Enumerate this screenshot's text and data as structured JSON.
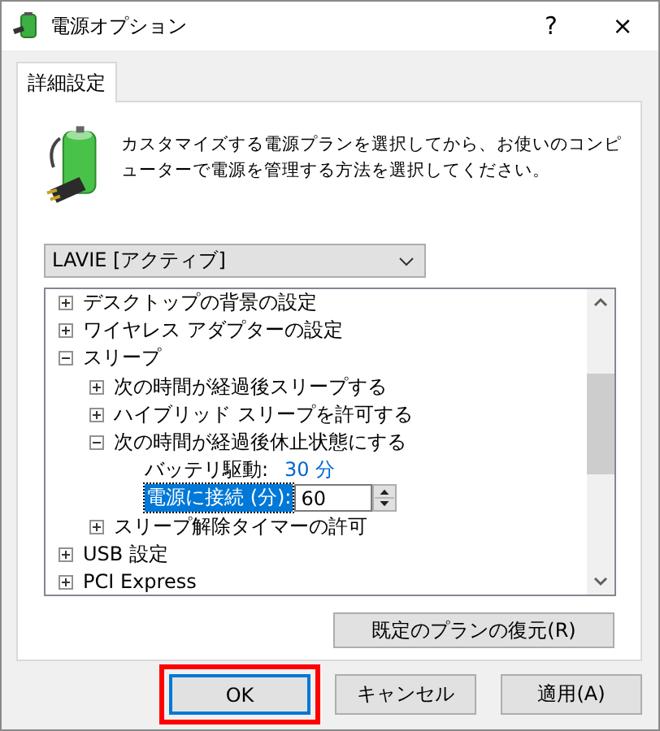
{
  "window": {
    "title": "電源オプション",
    "help": "?",
    "close": "×"
  },
  "tabs": [
    {
      "label": "詳細設定",
      "selected": true
    }
  ],
  "description": "カスタマイズする電源プランを選択してから、お使いのコンピューターで電源を管理する方法を選択してください。",
  "plan_dropdown": {
    "value": "LAVIE [アクティブ]"
  },
  "settings_tree": [
    {
      "label": "デスクトップの背景の設定",
      "expanded": false
    },
    {
      "label": "ワイヤレス アダプターの設定",
      "expanded": false
    },
    {
      "label": "スリープ",
      "expanded": true,
      "children": [
        {
          "label": "次の時間が経過後スリープする",
          "expanded": false
        },
        {
          "label": "ハイブリッド スリープを許可する",
          "expanded": false
        },
        {
          "label": "次の時間が経過後休止状態にする",
          "expanded": true,
          "children": [
            {
              "kind": "value",
              "label": "バッテリ駆動:",
              "value": "30 分",
              "selected": false
            },
            {
              "kind": "spin",
              "label": "電源に接続 (分):",
              "value": "60",
              "selected": true
            }
          ]
        },
        {
          "label": "スリープ解除タイマーの許可",
          "expanded": false
        }
      ]
    },
    {
      "label": "USB 設定",
      "expanded": false
    },
    {
      "label": "PCI Express",
      "expanded": false
    }
  ],
  "restore_button": "既定のプランの復元(R)",
  "buttons": [
    {
      "label": "OK",
      "focused": true,
      "highlighted": true
    },
    {
      "label": "キャンセル",
      "focused": false,
      "highlighted": false
    },
    {
      "label": "適用(A)",
      "focused": false,
      "highlighted": false
    }
  ]
}
